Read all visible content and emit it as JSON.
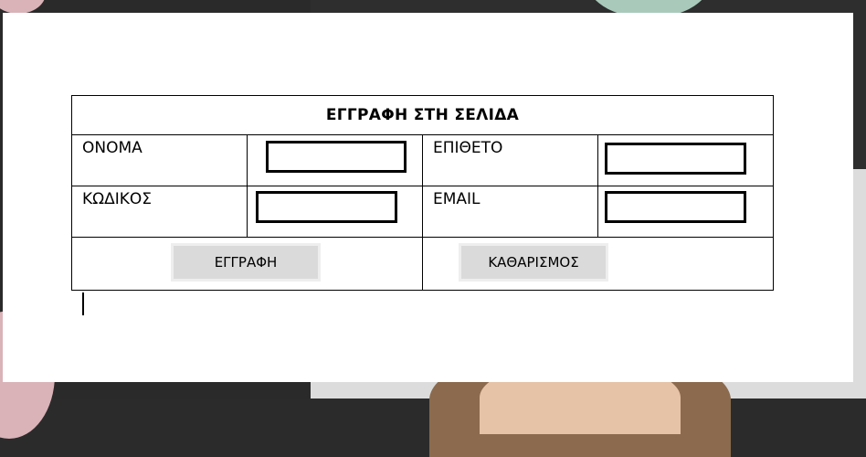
{
  "form": {
    "title": "ΕΓΓΡΑΦΗ ΣΤΗ ΣΕΛΙΔΑ",
    "first_name_label": "ΟΝΟΜΑ",
    "first_name_value": "",
    "last_name_label": "ΕΠΙΘΕΤΟ",
    "last_name_value": "",
    "code_label": "ΚΩΔΙΚΟΣ",
    "code_value": "",
    "email_label": "EMAIL",
    "email_value": "",
    "register_button": "ΕΓΓΡΑΦΗ",
    "clear_button": "ΚΑΘΑΡΙΣΜΟΣ"
  }
}
